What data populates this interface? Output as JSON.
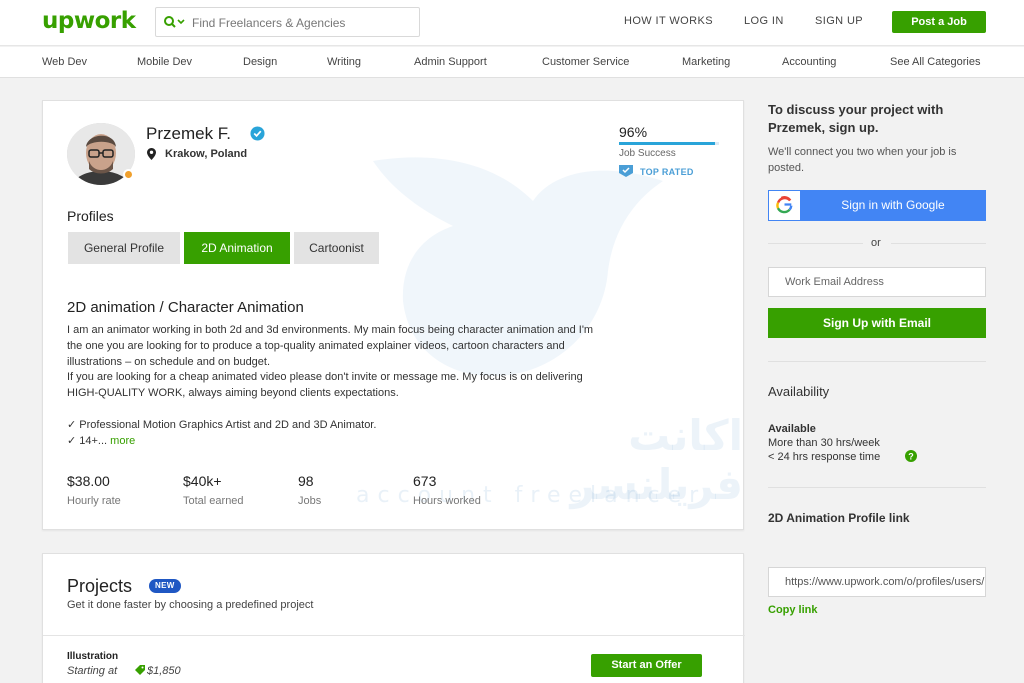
{
  "header": {
    "logo_up": "up",
    "logo_work": "work",
    "search_placeholder": "Find Freelancers & Agencies",
    "nav": [
      "HOW IT WORKS",
      "LOG IN",
      "SIGN UP"
    ],
    "post_job": "Post a Job"
  },
  "categories": [
    "Web Dev",
    "Mobile Dev",
    "Design",
    "Writing",
    "Admin Support",
    "Customer Service",
    "Marketing",
    "Accounting",
    "See All Categories"
  ],
  "profile": {
    "name": "Przemek F.",
    "location": "Krakow, Poland",
    "job_success_pct": "96%",
    "job_success_value": 96,
    "job_success_label": "Job Success",
    "top_rated": "TOP RATED",
    "profiles_heading": "Profiles",
    "tabs": [
      "General Profile",
      "2D Animation",
      "Cartoonist"
    ],
    "active_tab": "2D Animation",
    "title": "2D animation / Character Animation",
    "description": [
      "I am an animator working in both 2d and 3d environments. My main focus being character animation and I'm",
      "the one you are looking for to produce a top-quality animated explainer videos, cartoon characters and",
      "illustrations – on schedule and on budget.",
      "If you are looking for a cheap animated video please don't invite or message me. My focus is on delivering",
      "HIGH-QUALITY WORK, always aiming beyond clients expectations.",
      "✓ Professional Motion Graphics Artist and 2D and 3D Animator.",
      "✓ 14+..."
    ],
    "more": "more",
    "stats": [
      {
        "value": "$38.00",
        "label": "Hourly rate"
      },
      {
        "value": "$40k+",
        "label": "Total earned"
      },
      {
        "value": "98",
        "label": "Jobs"
      },
      {
        "value": "673",
        "label": "Hours worked"
      }
    ]
  },
  "watermark": {
    "arabic": "اکانت فریلنسر",
    "latin": "account freelancer"
  },
  "projects": {
    "heading": "Projects",
    "badge": "NEW",
    "subtitle": "Get it done faster by choosing a predefined project",
    "item_title": "Illustration",
    "starting_at": "Starting at",
    "price": "$1,850",
    "offer_button": "Start an Offer"
  },
  "sidebar": {
    "heading": "To discuss your project with Przemek, sign up.",
    "subtext": "We'll connect you two when your job is posted.",
    "google_button": "Sign in with Google",
    "or": "or",
    "email_placeholder": "Work Email Address",
    "signup_button": "Sign Up with Email",
    "availability_heading": "Availability",
    "available": "Available",
    "hours": "More than 30 hrs/week",
    "response": "< 24 hrs response time",
    "link_heading": "2D Animation Profile link",
    "link_value": "https://www.upwork.com/o/profiles/users/",
    "copy_link": "Copy link"
  },
  "colors": {
    "brand_green": "#37a000",
    "google_blue": "#4285f4",
    "badge_blue": "#1f57c3",
    "job_success_blue": "#29a4d9"
  }
}
